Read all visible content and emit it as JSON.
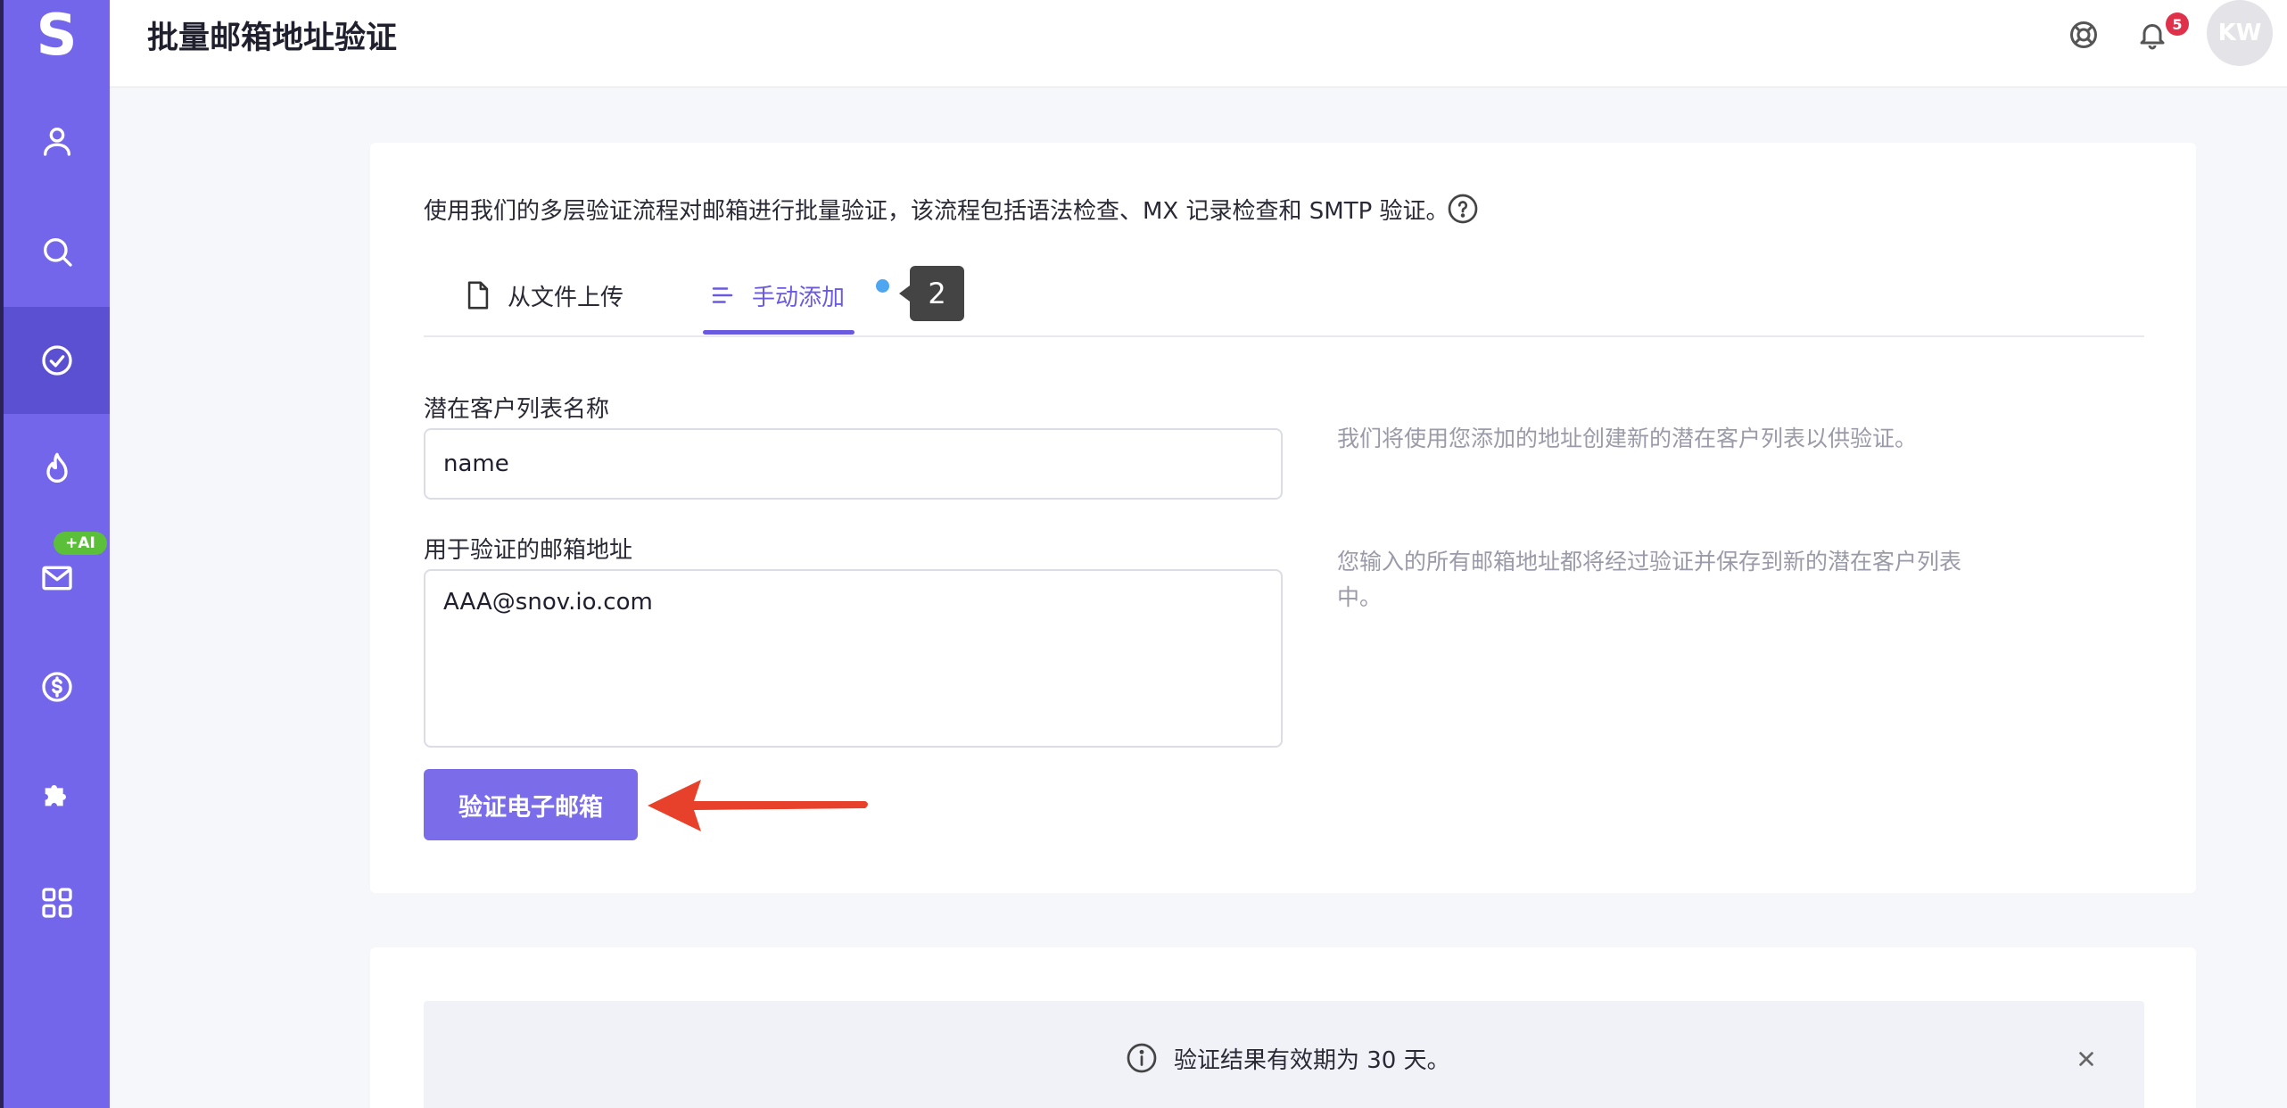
{
  "app": {
    "logo": "S",
    "accent": "#7466ea",
    "active_nav": "#5b4fd2"
  },
  "sidebar": {
    "items": [
      {
        "name": "contacts",
        "icon": "user-icon"
      },
      {
        "name": "search",
        "icon": "search-icon"
      },
      {
        "name": "verify",
        "icon": "check-circle-icon",
        "active": true
      },
      {
        "name": "warmup",
        "icon": "flame-icon"
      },
      {
        "name": "email",
        "icon": "mail-icon",
        "badge": "+AI"
      },
      {
        "name": "deals",
        "icon": "dollar-icon"
      },
      {
        "name": "integrations",
        "icon": "puzzle-icon"
      },
      {
        "name": "apps",
        "icon": "grid-icon"
      }
    ]
  },
  "header": {
    "title": "批量邮箱地址验证",
    "notifications": "5",
    "avatar": "KW"
  },
  "main": {
    "description": "使用我们的多层验证流程对邮箱进行批量验证，该流程包括语法检查、MX 记录检查和 SMTP 验证。",
    "tabs": [
      {
        "label": "从文件上传",
        "icon": "file-icon",
        "active": false
      },
      {
        "label": "手动添加",
        "icon": "list-icon",
        "active": true
      }
    ],
    "step_badge": "2",
    "list_name_label": "潜在客户列表名称",
    "list_name_value": "name",
    "list_name_hint": "我们将使用您添加的地址创建新的潜在客户列表以供验证。",
    "emails_label": "用于验证的邮箱地址",
    "emails_value": "AAA@snov.io.com",
    "emails_hint": "您输入的所有邮箱地址都将经过验证并保存到新的潜在客户列表中。",
    "verify_button": "验证电子邮箱"
  },
  "notice": {
    "text": "验证结果有效期为 30 天。"
  }
}
